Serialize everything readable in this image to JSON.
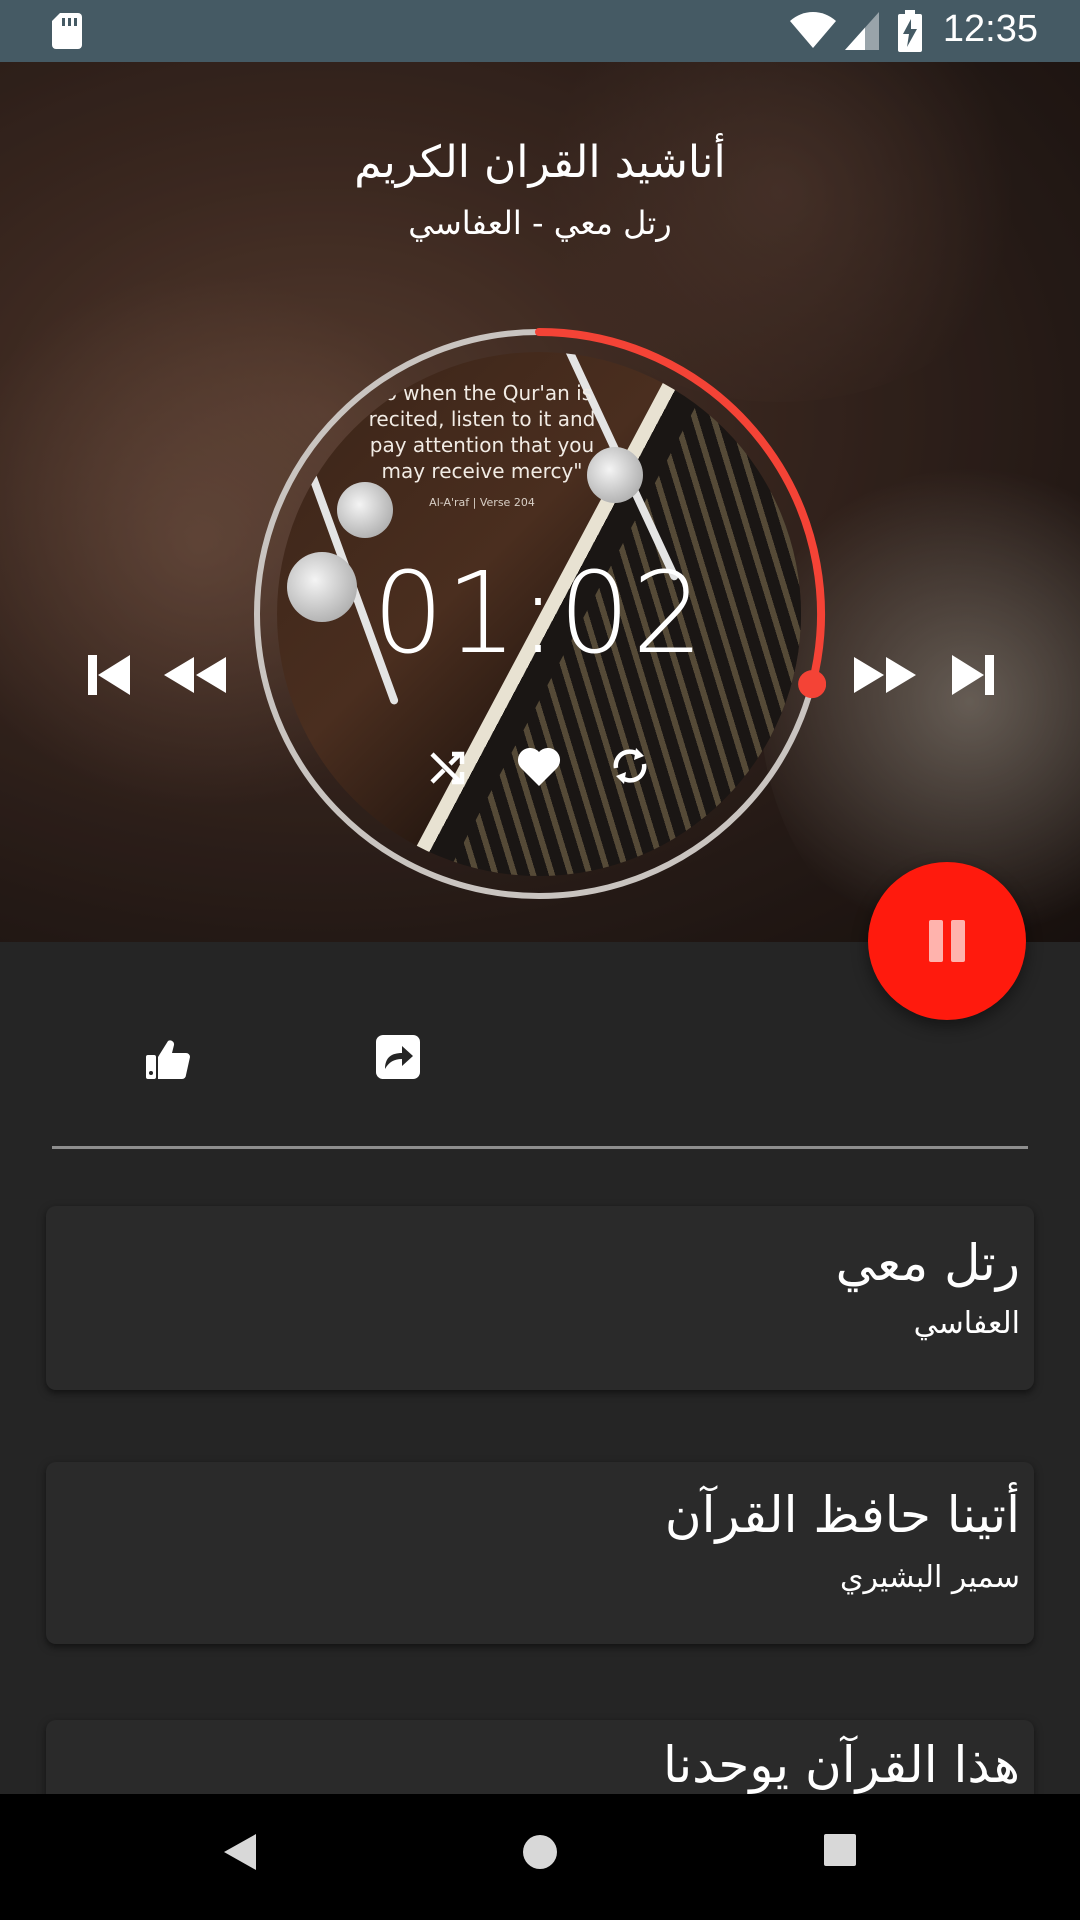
{
  "status_bar": {
    "time": "12:35"
  },
  "header": {
    "title": "أناشيد القران الكريم",
    "subtitle": "رتل معي - العفاسي"
  },
  "player": {
    "elapsed": "01:02",
    "progress": 0.29,
    "artwork_quote": "So when the Qur'an is recited, listen to it and pay attention that you may receive mercy\"",
    "artwork_source": "Al-A'raf | Verse 204",
    "accent_color": "#f44336",
    "fab_color": "#ff1a0d"
  },
  "tracks": [
    {
      "title": "رتل معي",
      "artist": "العفاسي"
    },
    {
      "title": "أتينا حافظ القرآن",
      "artist": "سمير البشيري"
    },
    {
      "title": "هذا القرآن يوحدنا",
      "artist": ""
    }
  ],
  "icons": {
    "status": [
      "sd-card-icon",
      "wifi-icon",
      "signal-icon",
      "battery-charging-icon"
    ],
    "transport": [
      "skip-previous-icon",
      "rewind-icon",
      "fast-forward-icon",
      "skip-next-icon"
    ],
    "disc": [
      "shuffle-icon",
      "heart-icon",
      "repeat-icon"
    ],
    "actions": [
      "thumbs-up-icon",
      "share-icon"
    ],
    "nav": [
      "back-icon",
      "home-icon",
      "recents-icon"
    ]
  }
}
